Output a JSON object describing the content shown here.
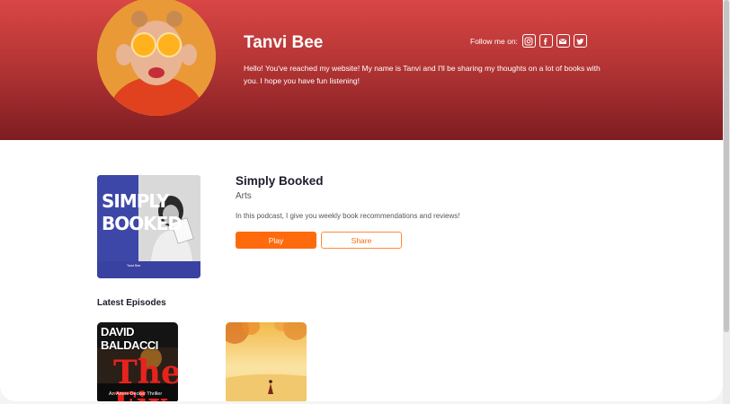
{
  "profile": {
    "name": "Tanvi Bee",
    "bio": "Hello! You've reached my website! My name is Tanvi and I'll be sharing my thoughts on a lot of books with you. I hope you have fun listening!",
    "follow_label": "Follow me on:",
    "social_icons": [
      "instagram-icon",
      "facebook-icon",
      "email-icon",
      "twitter-icon"
    ]
  },
  "podcast": {
    "cover_title_line1": "SIMPLY",
    "cover_title_line2": "BOOKED",
    "cover_caption": "Tanvi Bee",
    "title": "Simply Booked",
    "category": "Arts",
    "description": "In this podcast, I give you weekly book recommendations and reviews!",
    "play_label": "Play",
    "share_label": "Share"
  },
  "latest": {
    "heading": "Latest Episodes",
    "episodes": [
      {
        "author": "DAVID BALDACCI",
        "title": "The Fix",
        "subtitle": "An Amos Decker Thriller"
      },
      {
        "author": "",
        "title": "",
        "subtitle": ""
      }
    ]
  },
  "colors": {
    "hero_top": "#d94646",
    "hero_bottom": "#7e1d22",
    "accent": "#ff6a0c"
  }
}
